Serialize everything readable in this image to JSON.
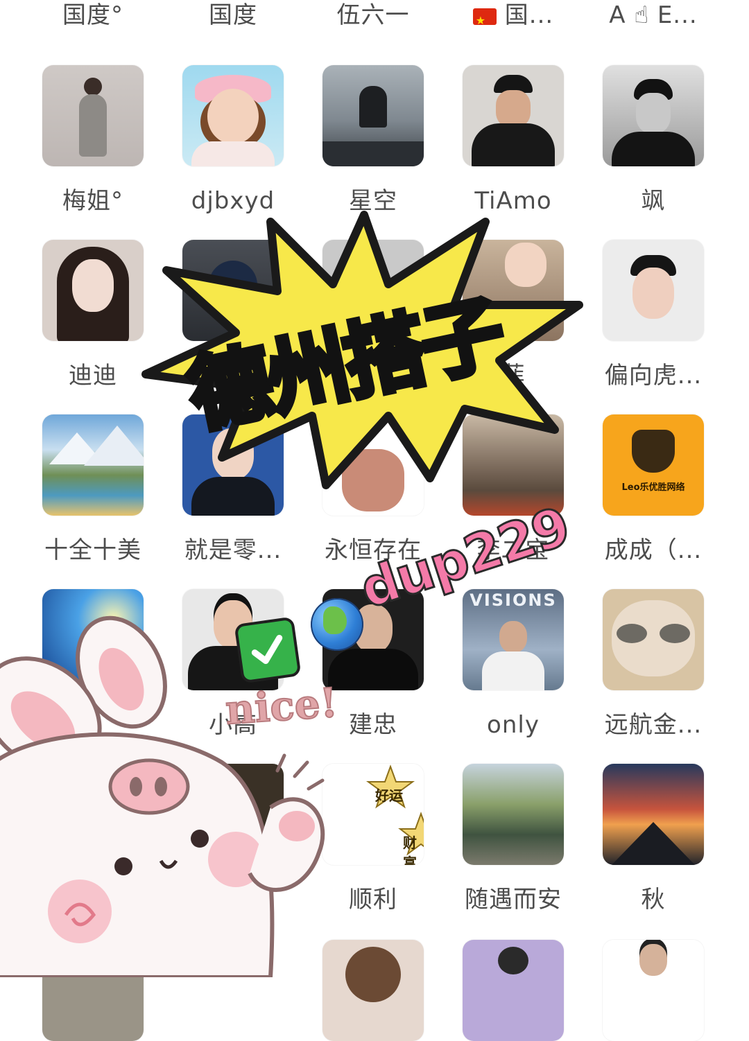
{
  "top_row": [
    {
      "name": "国度°"
    },
    {
      "name": "国度"
    },
    {
      "name": "伍六一"
    },
    {
      "name": "国...",
      "has_flag": true
    },
    {
      "name": "A ☝ E..."
    }
  ],
  "contacts": [
    {
      "name": "梅姐°"
    },
    {
      "name": "djbxyd"
    },
    {
      "name": "星空"
    },
    {
      "name": "TiAmo"
    },
    {
      "name": "飒"
    },
    {
      "name": "迪迪"
    },
    {
      "name": ""
    },
    {
      "name": ""
    },
    {
      "name": "菲"
    },
    {
      "name": "偏向虎..."
    },
    {
      "name": "十全十美"
    },
    {
      "name": "就是零..."
    },
    {
      "name": "永恒存在"
    },
    {
      "name": "李二宝"
    },
    {
      "name": "成成（..."
    },
    {
      "name": ""
    },
    {
      "name": "小高"
    },
    {
      "name": "建忠"
    },
    {
      "name": "only"
    },
    {
      "name": "远航金..."
    },
    {
      "name": ""
    },
    {
      "name": ""
    },
    {
      "name": "顺利"
    },
    {
      "name": "随遇而安"
    },
    {
      "name": "秋"
    }
  ],
  "overlays": {
    "burst_text": "德州搭子",
    "handle": "dup229",
    "nice_text": "nice!",
    "star1": "好运",
    "star2": "财富",
    "leo_logo_text": "Leo乐优胜网络",
    "visions_text": "VISIONS"
  },
  "colors": {
    "burst_fill": "#f7e84a",
    "burst_stroke": "#1a1a1a",
    "handle_pink": "#f47aa8",
    "leo_bg": "#f7a51c"
  }
}
